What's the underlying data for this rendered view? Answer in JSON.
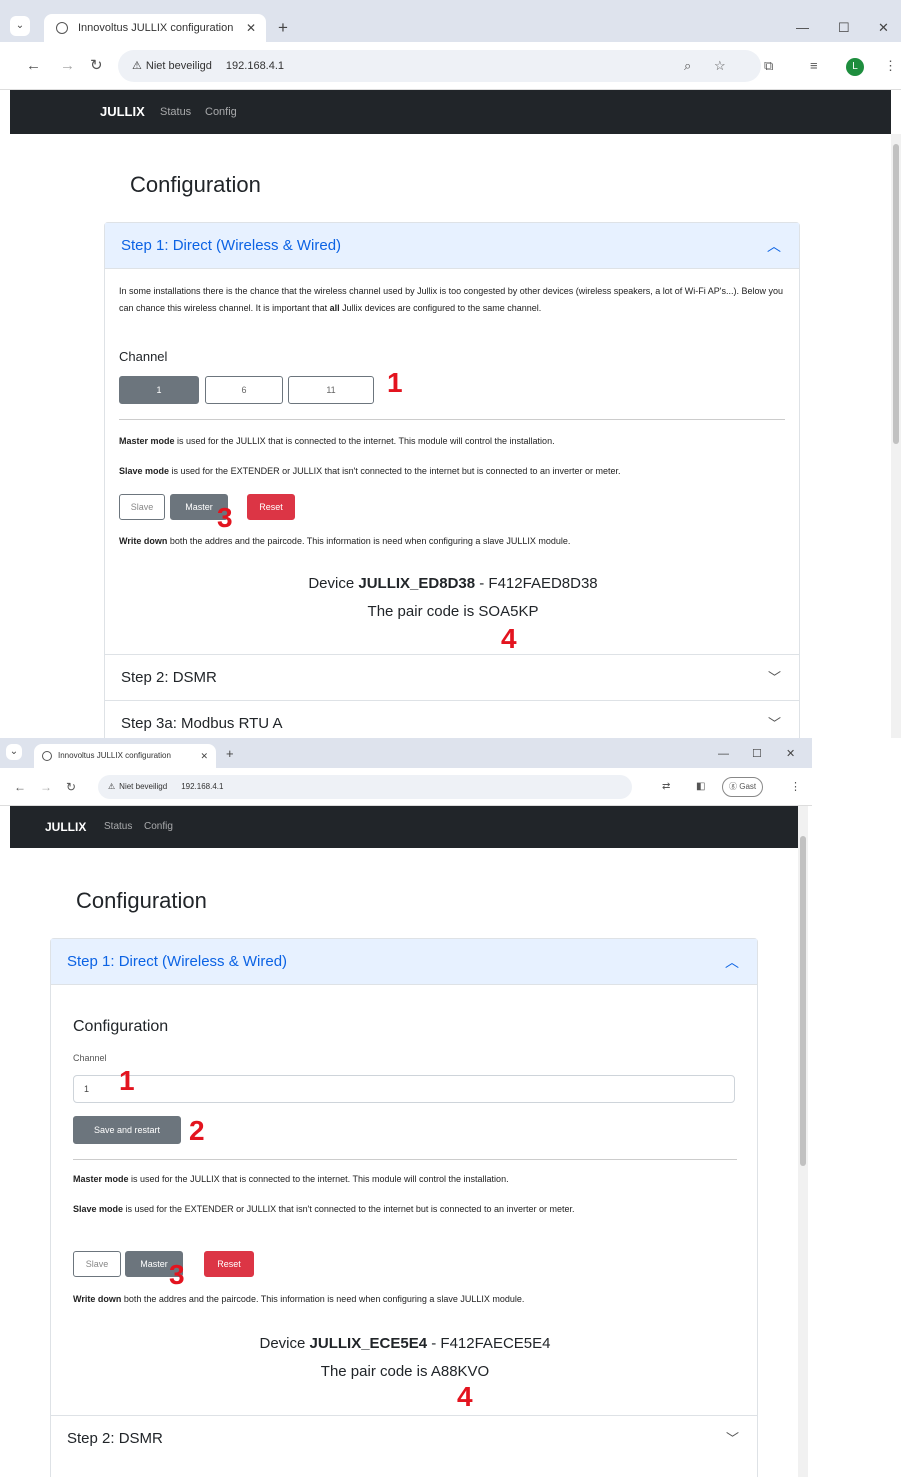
{
  "s1": {
    "tab_title": "Innovoltus JULLIX configuration",
    "security_label": "Niet beveiligd",
    "url": "192.168.4.1",
    "profile_initial": "L",
    "nav": {
      "brand": "JULLIX",
      "status": "Status",
      "config": "Config"
    },
    "page_title": "Configuration",
    "step1": {
      "header": "Step 1: Direct (Wireless & Wired)",
      "intro_a": "In some installations there is the chance that the wireless channel used by Jullix is too congested by other devices (wireless speakers, a lot of Wi-Fi AP's...). Below you can chance this wireless channel. It is important that ",
      "intro_bold": "all",
      "intro_b": " Jullix devices are configured to the same channel.",
      "channel_label": "Channel",
      "channels": [
        "1",
        "6",
        "11"
      ],
      "selected_channel": "1",
      "master_bold": "Master mode",
      "master_text": " is used for the JULLIX that is connected to the internet. This module will control the installation.",
      "slave_bold": "Slave mode",
      "slave_text": " is used for the EXTENDER or JULLIX that isn't connected to the internet but is connected to an inverter or meter.",
      "btn_slave": "Slave",
      "btn_master": "Master",
      "btn_reset": "Reset",
      "write_bold": "Write down",
      "write_text": " both the addres and the paircode. This information is need when configuring a slave JULLIX module.",
      "device_prefix": "Device ",
      "device_name": "JULLIX_ED8D38",
      "device_suffix": " - F412FAED8D38",
      "pair_prefix": "The pair code is ",
      "pair_code": "SOA5KP"
    },
    "step2": "Step 2: DSMR",
    "step3a": "Step 3a: Modbus RTU A",
    "annotations": [
      "1",
      "3",
      "4"
    ]
  },
  "s2": {
    "tab_title": "Innovoltus JULLIX configuration",
    "security_label": "Niet beveiligd",
    "url": "192.168.4.1",
    "guest_label": "Gast",
    "nav": {
      "brand": "JULLIX",
      "status": "Status",
      "config": "Config"
    },
    "page_title": "Configuration",
    "step1": {
      "header": "Step 1: Direct (Wireless & Wired)",
      "sub_title": "Configuration",
      "channel_label": "Channel",
      "channel_value": "1",
      "save_btn": "Save and restart",
      "master_bold": "Master mode",
      "master_text": " is used for the JULLIX that is connected to the internet. This module will control the installation.",
      "slave_bold": "Slave mode",
      "slave_text": " is used for the EXTENDER or JULLIX that isn't connected to the internet but is connected to an inverter or meter.",
      "btn_slave": "Slave",
      "btn_master": "Master",
      "btn_reset": "Reset",
      "write_bold": "Write down",
      "write_text": " both the addres and the paircode. This information is need when configuring a slave JULLIX module.",
      "device_prefix": "Device ",
      "device_name": "JULLIX_ECE5E4",
      "device_suffix": " - F412FAECE5E4",
      "pair_prefix": "The pair code is ",
      "pair_code": "A88KVO"
    },
    "step2": "Step 2: DSMR",
    "annotations": [
      "1",
      "2",
      "3",
      "4"
    ]
  },
  "colors": {
    "accent": "#0c63e4",
    "accent_bg": "#e7f1ff",
    "navbar": "#212529",
    "secondary": "#6c757d",
    "danger": "#dc3545",
    "annotation": "#e3141f"
  }
}
